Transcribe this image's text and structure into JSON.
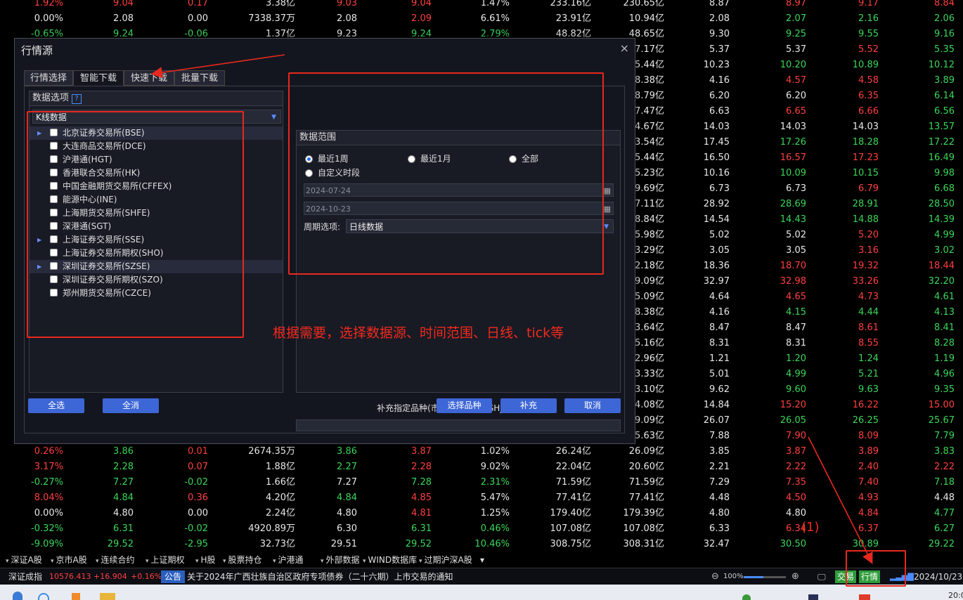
{
  "table_rows": [
    [
      "1.92%",
      "9.04",
      "0.17",
      "3.38亿",
      "9.03",
      "9.04",
      "1.47%",
      "233.16亿",
      "230.65亿",
      "8.87",
      "8.97",
      "9.17",
      "8.84"
    ],
    [
      "0.00%",
      "2.08",
      "0.00",
      "7338.37万",
      "2.08",
      "2.09",
      "6.61%",
      "23.91亿",
      "10.94亿",
      "2.08",
      "2.07",
      "2.16",
      "2.06"
    ],
    [
      "-0.65%",
      "9.24",
      "-0.06",
      "1.37亿",
      "9.23",
      "9.24",
      "2.79%",
      "48.82亿",
      "48.65亿",
      "9.30",
      "9.25",
      "9.55",
      "9.16"
    ],
    [
      "",
      "",
      "",
      "",
      "",
      "",
      "",
      "",
      "7.17亿",
      "5.37",
      "5.37",
      "5.52",
      "5.35"
    ],
    [
      "",
      "",
      "",
      "",
      "",
      "",
      "",
      "",
      "5.44亿",
      "10.23",
      "10.20",
      "10.89",
      "10.12"
    ],
    [
      "",
      "",
      "",
      "",
      "",
      "",
      "",
      "",
      "8.38亿",
      "4.16",
      "4.57",
      "4.58",
      "3.89"
    ],
    [
      "",
      "",
      "",
      "",
      "",
      "",
      "",
      "",
      "8.79亿",
      "6.20",
      "6.20",
      "6.35",
      "6.14"
    ],
    [
      "",
      "",
      "",
      "",
      "",
      "",
      "",
      "",
      "7.47亿",
      "6.63",
      "6.65",
      "6.66",
      "6.56"
    ],
    [
      "",
      "",
      "",
      "",
      "",
      "",
      "",
      "",
      "4.67亿",
      "14.03",
      "14.03",
      "14.03",
      "13.57"
    ],
    [
      "",
      "",
      "",
      "",
      "",
      "",
      "",
      "",
      "3.54亿",
      "17.45",
      "17.26",
      "18.28",
      "17.22"
    ],
    [
      "",
      "",
      "",
      "",
      "",
      "",
      "",
      "",
      "5.44亿",
      "16.50",
      "16.57",
      "17.23",
      "16.49"
    ],
    [
      "",
      "",
      "",
      "",
      "",
      "",
      "",
      "",
      "5.23亿",
      "10.16",
      "10.09",
      "10.15",
      "9.98"
    ],
    [
      "",
      "",
      "",
      "",
      "",
      "",
      "",
      "",
      "9.69亿",
      "6.73",
      "6.73",
      "6.79",
      "6.68"
    ],
    [
      "",
      "",
      "",
      "",
      "",
      "",
      "",
      "",
      "7.11亿",
      "28.92",
      "28.69",
      "28.91",
      "28.50"
    ],
    [
      "",
      "",
      "",
      "",
      "",
      "",
      "",
      "",
      "8.84亿",
      "14.54",
      "14.43",
      "14.88",
      "14.39"
    ],
    [
      "",
      "",
      "",
      "",
      "",
      "",
      "",
      "",
      "5.98亿",
      "5.02",
      "5.02",
      "5.20",
      "4.99"
    ],
    [
      "",
      "",
      "",
      "",
      "",
      "",
      "",
      "",
      "3.29亿",
      "3.05",
      "3.05",
      "3.16",
      "3.02"
    ],
    [
      "",
      "",
      "",
      "",
      "",
      "",
      "",
      "",
      "2.18亿",
      "18.36",
      "18.70",
      "19.32",
      "18.44"
    ],
    [
      "",
      "",
      "",
      "",
      "",
      "",
      "",
      "",
      "9.09亿",
      "32.97",
      "32.98",
      "33.26",
      "32.20"
    ],
    [
      "",
      "",
      "",
      "",
      "",
      "",
      "",
      "",
      "5.09亿",
      "4.64",
      "4.65",
      "4.73",
      "4.61"
    ],
    [
      "",
      "",
      "",
      "",
      "",
      "",
      "",
      "",
      "8.38亿",
      "4.16",
      "4.15",
      "4.44",
      "4.13"
    ],
    [
      "",
      "",
      "",
      "",
      "",
      "",
      "",
      "",
      "3.64亿",
      "8.47",
      "8.47",
      "8.61",
      "8.41"
    ],
    [
      "",
      "",
      "",
      "",
      "",
      "",
      "",
      "",
      "5.16亿",
      "8.31",
      "8.31",
      "8.55",
      "8.28"
    ],
    [
      "",
      "",
      "",
      "",
      "",
      "",
      "",
      "",
      "2.96亿",
      "1.21",
      "1.20",
      "1.24",
      "1.19"
    ],
    [
      "",
      "",
      "",
      "",
      "",
      "",
      "",
      "",
      "3.33亿",
      "5.01",
      "4.99",
      "5.21",
      "4.96"
    ],
    [
      "",
      "",
      "",
      "",
      "",
      "",
      "",
      "",
      "3.10亿",
      "9.62",
      "9.60",
      "9.63",
      "9.35"
    ],
    [
      "",
      "",
      "",
      "",
      "",
      "",
      "",
      "",
      "4.08亿",
      "14.84",
      "15.20",
      "16.22",
      "15.00"
    ],
    [
      "",
      "",
      "",
      "",
      "",
      "",
      "",
      "",
      "9.09亿",
      "26.07",
      "26.05",
      "26.25",
      "25.67"
    ],
    [
      "",
      "",
      "",
      "",
      "",
      "",
      "",
      "",
      "5.63亿",
      "7.88",
      "7.90",
      "8.09",
      "7.79"
    ],
    [
      "0.26%",
      "3.86",
      "0.01",
      "2674.35万",
      "3.86",
      "3.87",
      "1.02%",
      "26.24亿",
      "26.09亿",
      "3.85",
      "3.87",
      "3.89",
      "3.83"
    ],
    [
      "3.17%",
      "2.28",
      "0.07",
      "1.88亿",
      "2.27",
      "2.28",
      "9.02%",
      "22.04亿",
      "20.60亿",
      "2.21",
      "2.22",
      "2.40",
      "2.22"
    ],
    [
      "-0.27%",
      "7.27",
      "-0.02",
      "1.66亿",
      "7.27",
      "7.28",
      "2.31%",
      "71.59亿",
      "71.59亿",
      "7.29",
      "7.35",
      "7.40",
      "7.18"
    ],
    [
      "8.04%",
      "4.84",
      "0.36",
      "4.20亿",
      "4.84",
      "4.85",
      "5.47%",
      "77.41亿",
      "77.41亿",
      "4.48",
      "4.50",
      "4.93",
      "4.48"
    ],
    [
      "0.00%",
      "4.80",
      "0.00",
      "2.24亿",
      "4.80",
      "4.81",
      "1.25%",
      "179.40亿",
      "179.39亿",
      "4.80",
      "4.80",
      "4.84",
      "4.77"
    ],
    [
      "-0.32%",
      "6.31",
      "-0.02",
      "4920.89万",
      "6.30",
      "6.31",
      "0.46%",
      "107.08亿",
      "107.08亿",
      "6.33",
      "6.34",
      "6.37",
      "6.27"
    ],
    [
      "-9.09%",
      "29.52",
      "-2.95",
      "32.73亿",
      "29.51",
      "29.52",
      "10.46%",
      "308.75亿",
      "308.31亿",
      "32.47",
      "30.50",
      "30.89",
      "29.22"
    ]
  ],
  "table_colors": [
    "rrrwrrwwwwrrr",
    "wwwwwrwwwwggg",
    "ggg wggwwwggg",
    "wwwwwwwwwwwrg",
    "wwwwwwwwwwggg",
    "wwwwwwwwwwrrg",
    "wwwwwwwwwwwrg",
    "wwwwwwwwwwrrg",
    "wwwwwwwwwwwwg",
    "wwwwwwwwwwggg",
    "wwwwwwwwwwrrg",
    "wwwwwwwwwwggg",
    "wwwwwwwwwwwrg",
    "wwwwwwwwwwggg",
    "wwwwwwwwwwggg",
    "wwwwwwwwwwwrg",
    "wwwwwwwwwwwrg",
    "wwwwwwwwwwrrr",
    "wwwwwwwwwwrrg",
    "wwwwwwwwwwrrg",
    "wwwwwwwwwwggg",
    "wwwwwwwwwwwrg",
    "wwwwwwwwwwwrg",
    "wwwwwwwwwwggg",
    "wwwwwwwwwwggg",
    "wwwwwwwwwwggg",
    "wwwwwwwwwwrrr",
    "wwwwwwwwwwggg",
    "wwwwwwwwwwrrg",
    "rgrwgrwwwwrrg",
    "rgrwgrwwwwrrr",
    "ggg wggwwwrrg",
    "rgrwgrwwwwrrw",
    "wwwwwrwwwwwrg",
    "ggg wggwwwrrg",
    "ggg wggwwwggg"
  ],
  "bottom_tabs": [
    "深证A股",
    "京市A股",
    "连续合约",
    "上证期权",
    "H股",
    "股票持仓",
    "沪港通",
    "外部数据",
    "WIND数据库",
    "过期沪深A股"
  ],
  "status": {
    "index_name": "深证成指",
    "index_value": "10576.413",
    "index_change": "+16.904",
    "index_pct": "+0.16%",
    "notice_tag": "公告",
    "notice_text": "关于2024年广西壮族自治区政府专项债券（二十六期）上市交易的通知",
    "zoom": "100%",
    "trade_label": "交易",
    "quote_label": "行情",
    "date": "2024/10/23",
    "clock": "20:0"
  },
  "dialog": {
    "title": "行情源",
    "close": "×",
    "tabs": [
      "行情选择",
      "智能下载",
      "快速下载",
      "批量下载"
    ],
    "active_tab": 1,
    "data_options": {
      "header": "数据选项",
      "help": "?",
      "type_select": "K线数据",
      "exchanges": [
        {
          "label": "北京证券交易所(BSE)",
          "expandable": true,
          "highlight": true
        },
        {
          "label": "大连商品交易所(DCE)",
          "expandable": false,
          "highlight": false
        },
        {
          "label": "沪港通(HGT)",
          "expandable": false,
          "highlight": false
        },
        {
          "label": "香港联合交易所(HK)",
          "expandable": false,
          "highlight": false
        },
        {
          "label": "中国金融期货交易所(CFFEX)",
          "expandable": false,
          "highlight": false
        },
        {
          "label": "能源中心(INE)",
          "expandable": false,
          "highlight": false
        },
        {
          "label": "上海期货交易所(SHFE)",
          "expandable": false,
          "highlight": false
        },
        {
          "label": "深港通(SGT)",
          "expandable": false,
          "highlight": false
        },
        {
          "label": "上海证券交易所(SSE)",
          "expandable": true,
          "highlight": false
        },
        {
          "label": "上海证券交易所期权(SHO)",
          "expandable": false,
          "highlight": false
        },
        {
          "label": "深圳证券交易所(SZSE)",
          "expandable": true,
          "highlight": true
        },
        {
          "label": "深圳证券交易所期权(SZO)",
          "expandable": false,
          "highlight": false
        },
        {
          "label": "郑州期货交易所(CZCE)",
          "expandable": false,
          "highlight": false
        }
      ]
    },
    "data_range": {
      "header": "数据范围",
      "radio_week": "最近1周",
      "radio_month": "最近1月",
      "radio_all": "全部",
      "radio_custom": "自定义时段",
      "selected": "最近1周",
      "start_date": "2024-07-24",
      "end_date": "2024-10-23",
      "period_label": "周期选项:",
      "period_value": "日线数据"
    },
    "supplement_label": "补充指定品种(市场_代码,例如SH_600000)",
    "supplement_value": "",
    "buttons": {
      "select_all": "全选",
      "clear_all": "全消",
      "select_symbols": "选择品种",
      "supplement": "补充",
      "cancel": "取消"
    }
  },
  "annotations": {
    "main_text": "根据需要，选择数据源、时间范围、日线、tick等",
    "step_label": "(1)"
  },
  "colors": {
    "up": "#ff4040",
    "down": "#3bd65a",
    "accent_button": "#3d66d6",
    "annotation_red": "#e8281e"
  }
}
